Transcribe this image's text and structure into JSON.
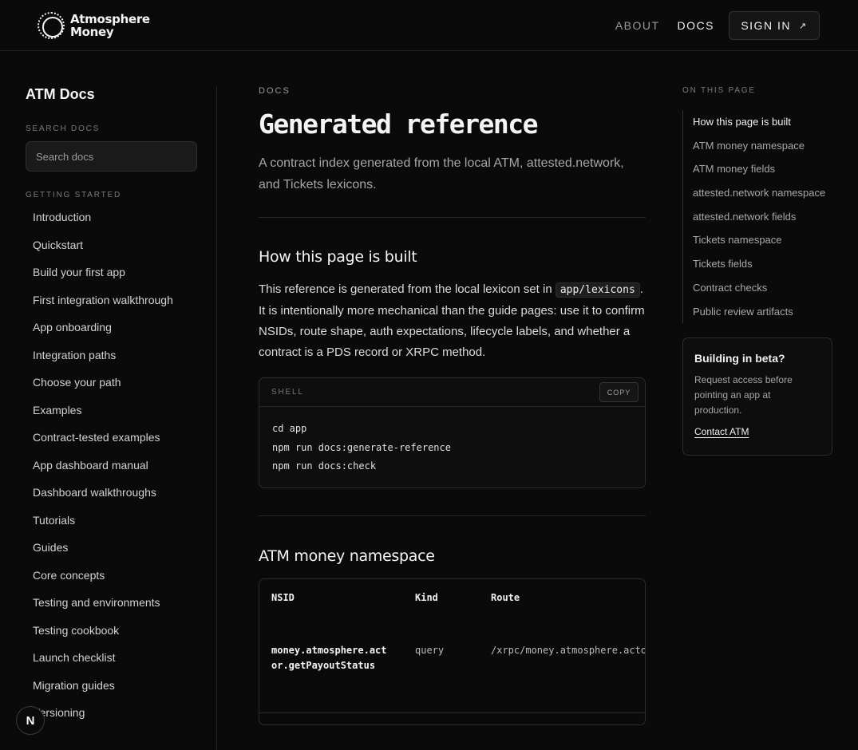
{
  "header": {
    "brand_line1": "Atmosphere",
    "brand_line2": "Money",
    "nav": {
      "about": "ABOUT",
      "docs": "DOCS",
      "signin": "SIGN IN",
      "signin_icon": "↗"
    }
  },
  "sidebar": {
    "title": "ATM Docs",
    "search_label": "SEARCH DOCS",
    "search_placeholder": "Search docs",
    "group_label": "GETTING STARTED",
    "items": [
      "Introduction",
      "Quickstart",
      "Build your first app",
      "First integration walkthrough",
      "App onboarding",
      "Integration paths",
      "Choose your path",
      "Examples",
      "Contract-tested examples",
      "App dashboard manual",
      "Dashboard walkthroughs",
      "Tutorials",
      "Guides",
      "Core concepts",
      "Testing and environments",
      "Testing cookbook",
      "Launch checklist",
      "Migration guides",
      "Versioning"
    ]
  },
  "main": {
    "eyebrow": "DOCS",
    "title": "Generated reference",
    "lede": "A contract index generated from the local ATM, attested.network, and Tickets lexicons.",
    "section1": {
      "heading": "How this page is built",
      "p_before": "This reference is generated from the local lexicon set in ",
      "p_code": "app/lexicons",
      "p_after": ". It is intentionally more mechanical than the guide pages: use it to confirm NSIDs, route shape, auth expectations, lifecycle labels, and whether a contract is a PDS record or XRPC method."
    },
    "codeblock": {
      "lang": "SHELL",
      "copy": "COPY",
      "lines": [
        "cd app",
        "npm run docs:generate-reference",
        "npm run docs:check"
      ]
    },
    "section2": {
      "heading": "ATM money namespace",
      "table": {
        "headers": {
          "nsid": "NSID",
          "kind": "Kind",
          "route": "Route"
        },
        "row": {
          "nsid": "money.atmosphere.actor.getPayoutStatus",
          "kind": "query",
          "route": "/xrpc/money.atmosphere.actor.getPayoutStatus"
        }
      }
    }
  },
  "toc": {
    "label": "ON THIS PAGE",
    "items": [
      "How this page is built",
      "ATM money namespace",
      "ATM money fields",
      "attested.network namespace",
      "attested.network fields",
      "Tickets namespace",
      "Tickets fields",
      "Contract checks",
      "Public review artifacts"
    ],
    "active_index": 0
  },
  "beta": {
    "title": "Building in beta?",
    "text": "Request access before pointing an app at production.",
    "link": "Contact ATM"
  },
  "dev_badge": "N"
}
